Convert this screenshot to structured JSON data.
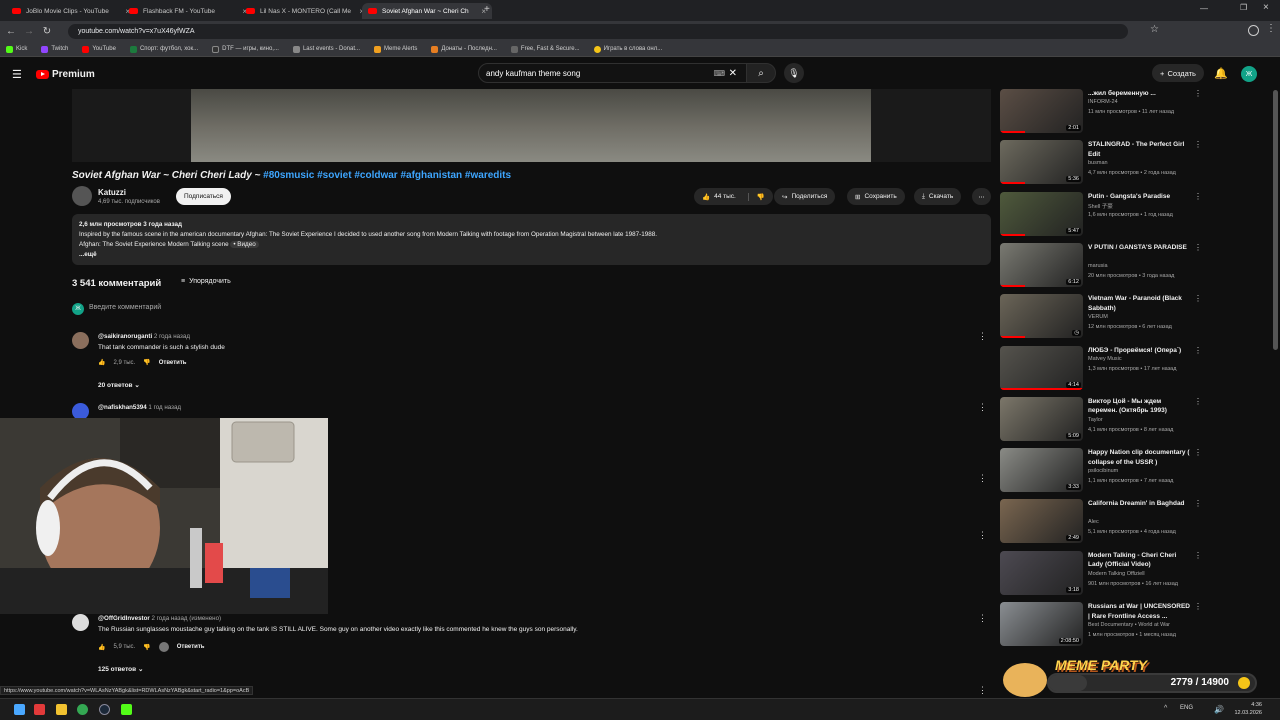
{
  "browser": {
    "tabs": [
      {
        "title": "JoBlo Movie Clips - YouTube",
        "active": false
      },
      {
        "title": "Flashback FM - YouTube",
        "active": false
      },
      {
        "title": "Lil Nas X - MONTERO (Call Me",
        "active": false
      },
      {
        "title": "Soviet Afghan War ~ Cheri Ch",
        "active": true
      }
    ],
    "url": "youtube.com/watch?v=x7uX46yfWZA",
    "bookmarks": [
      "Kick",
      "Twitch",
      "YouTube",
      "Спорт: футбол, хок...",
      "DTF — игры, кино,...",
      "Last events - Donat...",
      "Meme Alerts",
      "Донаты - Последн...",
      "Free, Fast & Secure...",
      "Играть в слова онл..."
    ]
  },
  "youtube": {
    "logo_text": "Premium",
    "search_query": "andy kaufman theme song",
    "create_label": "Создать",
    "avatar_letter": "Ж"
  },
  "video": {
    "title": "Soviet Afghan War ~ Cheri Cheri Lady ~",
    "tags": "#80smusic #soviet #coldwar #afghanistan #waredits",
    "channel": "Katuzzi",
    "subs": "4,69 тыс. подписчиков",
    "subscribe": "Подписаться",
    "likes": "44 тыс.",
    "share": "Поделиться",
    "save": "Сохранить",
    "download": "Скачать",
    "desc_stats": "2,6 млн просмотров  3 года назад",
    "desc_line1": "Inspired by the famous scene in the american documentary Afghan: The Soviet Experience I decided to used another song from Modern Talking with footage from Operation Magistral between late 1987-1988.",
    "desc_line2": "Afghan: The Soviet Experience Modern Talking scene",
    "desc_video": "• Видео",
    "desc_more": "...ещё"
  },
  "comments": {
    "count": "3 541 комментарий",
    "sort": "Упорядочить",
    "add_placeholder": "Введите комментарий",
    "reply_label": "Ответить",
    "items": [
      {
        "author": "@saikiranoruganti",
        "time": "2 года назад",
        "text": "That tank commander is such a stylish dude",
        "likes": "2,9 тыс.",
        "replies": "20 ответов"
      },
      {
        "author": "@nafiskhan5394",
        "time": "1 год назад",
        "text": "",
        "likes": "",
        "replies": ""
      },
      {
        "author": "@OffGridInvestor",
        "time": "2 года назад (изменено)",
        "text": "The Russian sunglasses moustache guy talking on the tank IS STILL ALIVE. Some guy on another video exactly like this commented he knew the guys son personally.",
        "likes": "5,9 тыс.",
        "replies": "125 ответов"
      }
    ]
  },
  "sidebar": [
    {
      "title": "...жил беременную ...",
      "channel": "INFORM-24",
      "meta": "11 млн просмотров • 11 лет назад",
      "duration": "2:01"
    },
    {
      "title": "STALINGRAD - The Perfect Girl Edit",
      "channel": "busman",
      "meta": "4,7 млн просмотров • 2 года назад",
      "duration": "5:36"
    },
    {
      "title": "Putin - Gangsta's Paradise",
      "channel": "Shell 子豪",
      "meta": "1,6 млн просмотров • 1 год назад",
      "duration": "5:47"
    },
    {
      "title": "V PUTIN / GANSTA'S PARADISE",
      "channel": "marusia",
      "meta": "20 млн просмотров • 3 года назад",
      "duration": "6:12"
    },
    {
      "title": "Vietnam War - Paranoid (Black Sabbath)",
      "channel": "VERUM",
      "meta": "12 млн просмотров • 6 лет назад",
      "duration": ""
    },
    {
      "title": "ЛЮБЭ - Прорвёмся! (Опера`)",
      "channel": "Matvey Music",
      "meta": "1,3 млн просмотров • 17 лет назад",
      "duration": "4:14"
    },
    {
      "title": "Виктор Цой - Мы ждем перемен. (Октябрь 1993)",
      "channel": "Taylor",
      "meta": "4,1 млн просмотров • 8 лет назад",
      "duration": "5:09"
    },
    {
      "title": "Happy Nation clip documentary ( collapse of the USSR )",
      "channel": "psilocibinum",
      "meta": "1,1 млн просмотров • 7 лет назад",
      "duration": "3:33"
    },
    {
      "title": "California Dreamin' in Baghdad",
      "channel": "Alec",
      "meta": "5,1 млн просмотров • 4 года назад",
      "duration": "2:49"
    },
    {
      "title": "Modern Talking - Cheri Cheri Lady (Official Video)",
      "channel": "Modern Talking Offiziell",
      "meta": "901 млн просмотров • 16 лет назад",
      "duration": "3:18"
    },
    {
      "title": "Russians at War | UNCENSORED | Rare Frontline Access ...",
      "channel": "Best Documentary • World at War",
      "meta": "1 млн просмотров • 1 месяц назад",
      "duration": "2:08:50"
    }
  ],
  "overlay": {
    "meme_party": "MEME PARTY",
    "counter": "2779 / 14900",
    "status_url": "https://www.youtube.com/watch?v=WLAsNzYABgk&list=RDWLAsNzYABgk&start_radio=1&pp=oAcB"
  },
  "taskbar": {
    "lang": "ENG",
    "time": "4:36",
    "date": "12.03.2026"
  },
  "colors": {
    "accent": "#ff0000",
    "link": "#3ea6ff",
    "avatar": "#12a388"
  }
}
